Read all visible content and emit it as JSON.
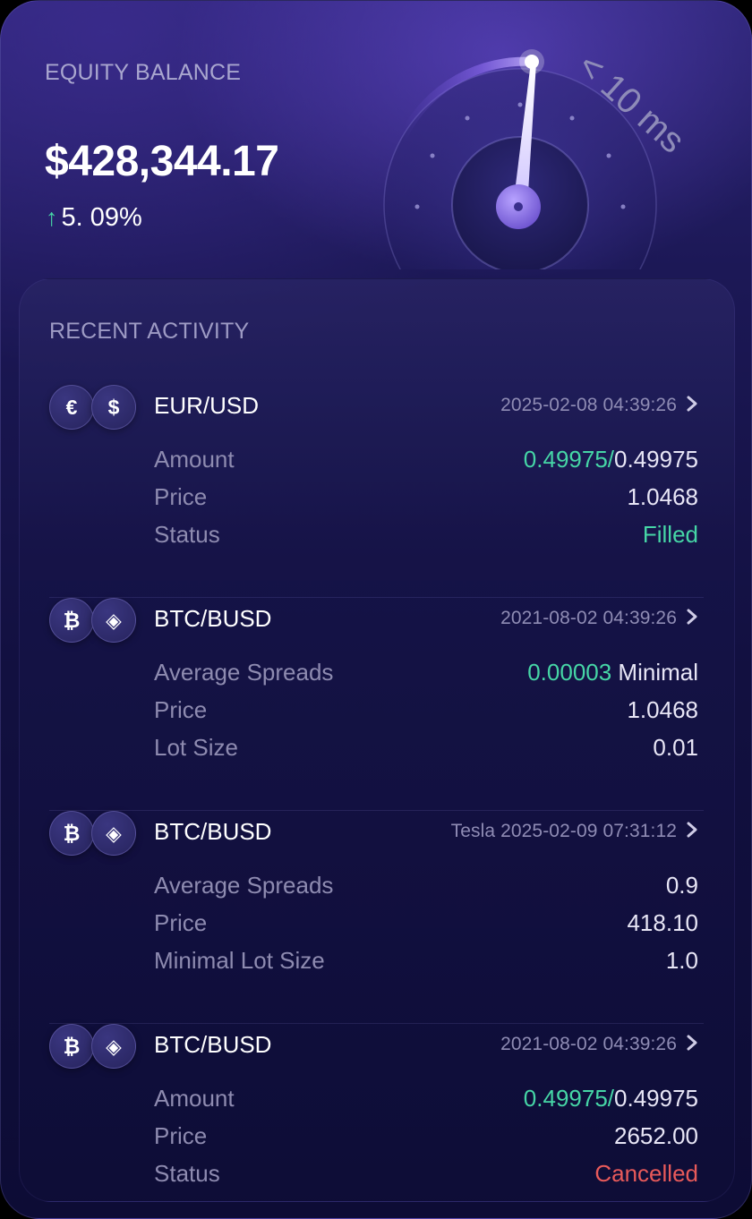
{
  "equity": {
    "label": "EQUITY BALANCE",
    "value": "$428,344.17",
    "change_arrow": "↑",
    "change": "5. 09%",
    "latency_label": "< 10 ms"
  },
  "activity": {
    "title": "RECENT ACTIVITY",
    "items": [
      {
        "pair": "EUR/USD",
        "icons": [
          "euro-icon",
          "dollar-icon"
        ],
        "icon_glyphs": [
          "€",
          "$"
        ],
        "timestamp": "2025-02-08 04:39:26",
        "rows": [
          {
            "label": "Amount",
            "value_highlight": "0.49975/",
            "value": "0.49975"
          },
          {
            "label": "Price",
            "value_highlight": "",
            "value": "1.0468"
          },
          {
            "label": "Status",
            "value_highlight": "",
            "value": "Filled",
            "status": "filled"
          }
        ]
      },
      {
        "pair": "BTC/BUSD",
        "icons": [
          "bitcoin-icon",
          "busd-icon"
        ],
        "icon_glyphs": [
          "₿",
          "◈"
        ],
        "timestamp": "2021-08-02 04:39:26",
        "rows": [
          {
            "label": "Average Spreads",
            "value_highlight": "0.00003",
            "value": " Minimal"
          },
          {
            "label": "Price",
            "value_highlight": "",
            "value": "1.0468"
          },
          {
            "label": "Lot Size",
            "value_highlight": "",
            "value": "0.01"
          }
        ]
      },
      {
        "pair": "BTC/BUSD",
        "icons": [
          "bitcoin-icon",
          "busd-icon"
        ],
        "icon_glyphs": [
          "₿",
          "◈"
        ],
        "timestamp": "Tesla 2025-02-09 07:31:12",
        "rows": [
          {
            "label": "Average Spreads",
            "value_highlight": "",
            "value": "0.9"
          },
          {
            "label": "Price",
            "value_highlight": "",
            "value": "418.10"
          },
          {
            "label": "Minimal Lot Size",
            "value_highlight": "",
            "value": "1.0"
          }
        ]
      },
      {
        "pair": "BTC/BUSD",
        "icons": [
          "bitcoin-icon",
          "busd-icon"
        ],
        "icon_glyphs": [
          "₿",
          "◈"
        ],
        "timestamp": "2021-08-02 04:39:26",
        "rows": [
          {
            "label": "Amount",
            "value_highlight": "0.49975/",
            "value": "0.49975"
          },
          {
            "label": "Price",
            "value_highlight": "",
            "value": "2652.00"
          },
          {
            "label": "Status",
            "value_highlight": "",
            "value": "Cancelled",
            "status": "cancelled"
          }
        ]
      }
    ]
  },
  "colors": {
    "accent_green": "#46d6a6",
    "accent_red": "#e85a5a",
    "gauge_purple": "#8a6cf0"
  }
}
